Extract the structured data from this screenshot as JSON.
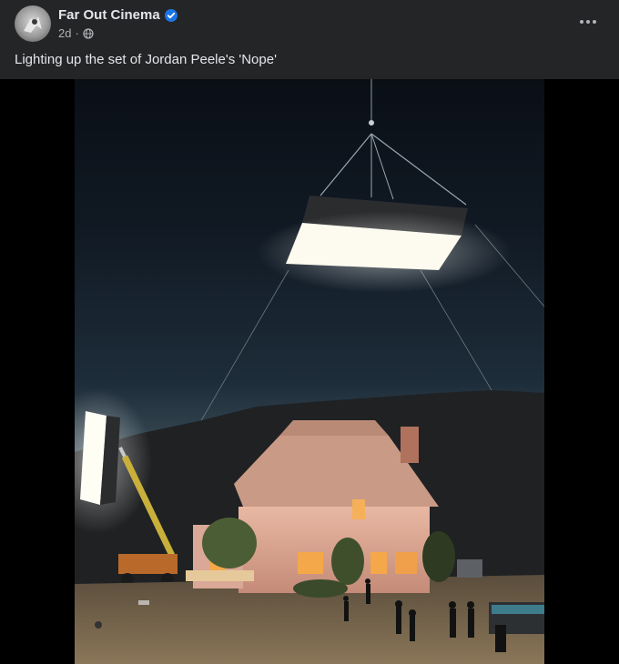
{
  "post": {
    "page_name": "Far Out Cinema",
    "timestamp": "2d",
    "separator": "·",
    "audience_icon": "globe-icon",
    "verified_icon": "verified-badge-icon",
    "more_icon": "more-options-icon",
    "caption": "Lighting up the set of Jordan Peele's 'Nope'"
  },
  "colors": {
    "background": "#242526",
    "primary_text": "#e4e6eb",
    "secondary_text": "#b0b3b8",
    "verified": "#1b74e4"
  }
}
